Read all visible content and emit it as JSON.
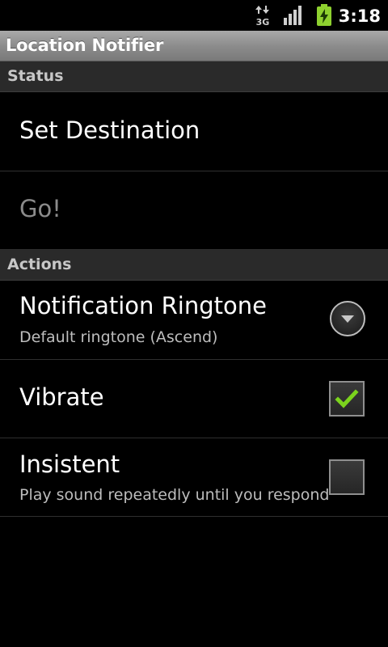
{
  "status_bar": {
    "network_type": "3G",
    "time": "3:18"
  },
  "app": {
    "title": "Location Notifier"
  },
  "status_section": {
    "header": "Status",
    "set_destination": "Set Destination",
    "go": "Go!"
  },
  "actions_section": {
    "header": "Actions",
    "ringtone": {
      "title": "Notification Ringtone",
      "summary": "Default ringtone (Ascend)"
    },
    "vibrate": {
      "title": "Vibrate",
      "checked": true
    },
    "insistent": {
      "title": "Insistent",
      "summary": "Play sound repeatedly until you respond",
      "checked": false
    }
  },
  "colors": {
    "checkmark": "#7bd31d",
    "battery": "#8ed12f"
  }
}
